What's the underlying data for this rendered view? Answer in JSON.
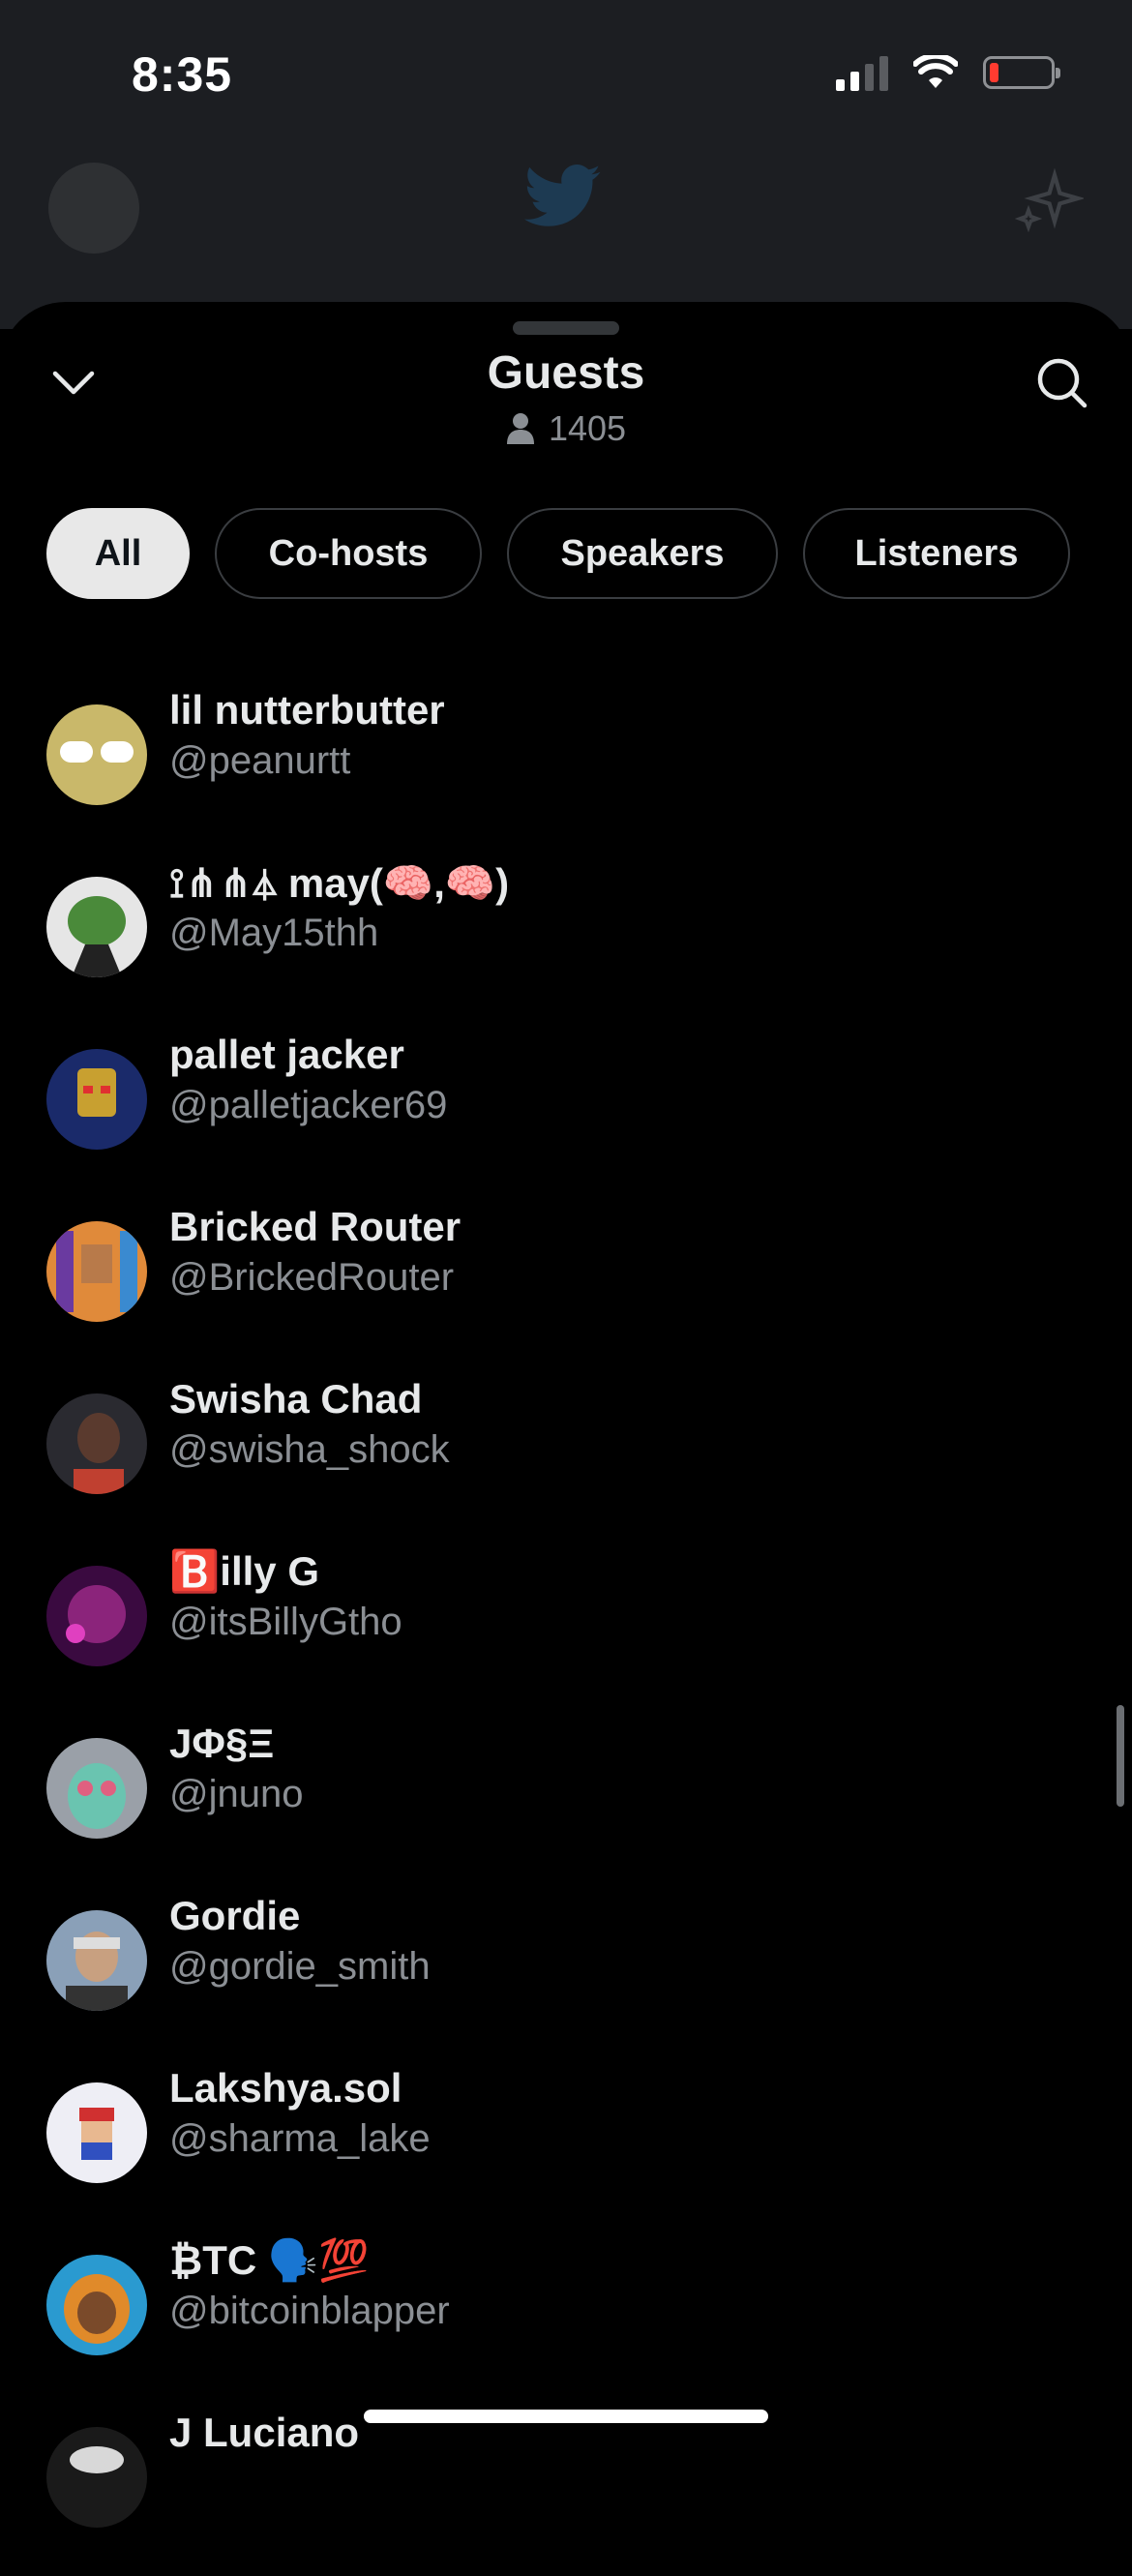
{
  "status_bar": {
    "time": "8:35"
  },
  "sheet": {
    "title": "Guests",
    "guest_count": "1405",
    "tabs": [
      {
        "label": "All",
        "active": true
      },
      {
        "label": "Co-hosts",
        "active": false
      },
      {
        "label": "Speakers",
        "active": false
      },
      {
        "label": "Listeners",
        "active": false
      }
    ]
  },
  "guests": [
    {
      "name": "lil nutterbutter",
      "handle": "@peanurtt",
      "avatar_color": "#c9b86a"
    },
    {
      "name": "⟟⋔⋔⏃ may(🧠,🧠)",
      "handle": "@May15thh",
      "avatar_color": "#4a8a3a"
    },
    {
      "name": "pallet jacker",
      "handle": "@palletjacker69",
      "avatar_color": "#2a3a8a"
    },
    {
      "name": "Bricked Router",
      "handle": "@BrickedRouter",
      "avatar_color": "#b8743a"
    },
    {
      "name": "Swisha Chad",
      "handle": "@swisha_shock",
      "avatar_color": "#5a3a2e"
    },
    {
      "name": "🅱️illy G",
      "handle": "@itsBillyGtho",
      "avatar_color": "#8a1a6a"
    },
    {
      "name": "JΦ§Ξ",
      "handle": "@jnuno",
      "avatar_color": "#6ac4b0"
    },
    {
      "name": "Gordie",
      "handle": "@gordie_smith",
      "avatar_color": "#7a8a9a"
    },
    {
      "name": "Lakshya.sol",
      "handle": "@sharma_lake",
      "avatar_color": "#e8e8f0"
    },
    {
      "name": "₿TC 🗣️💯",
      "handle": "@bitcoinblapper",
      "avatar_color": "#e08a2a"
    },
    {
      "name": "J Luciano",
      "handle": "",
      "avatar_color": "#d8d8d8"
    }
  ]
}
